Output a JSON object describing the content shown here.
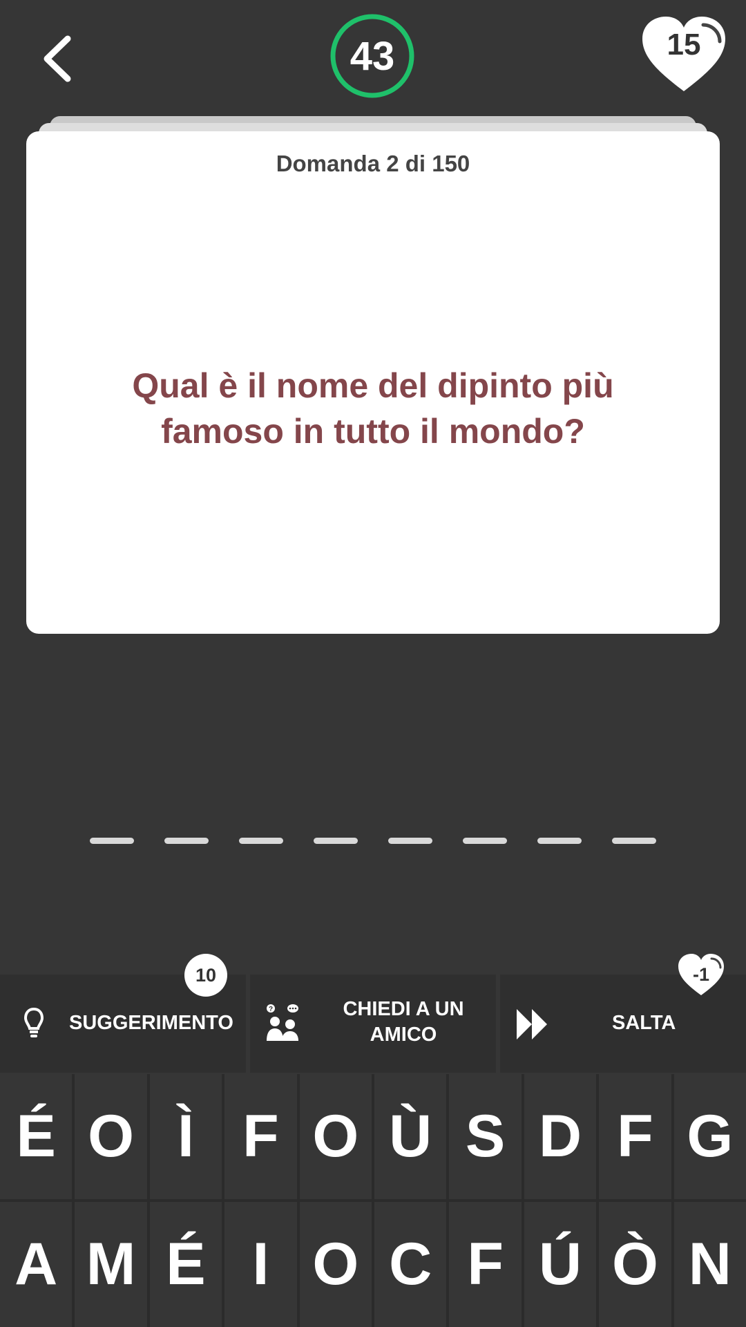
{
  "header": {
    "back_icon": "chevron-left-icon",
    "timer_value": "43",
    "timer_color": "#1fc06a",
    "lives_value": "15"
  },
  "card": {
    "counter": "Domanda 2 di 150",
    "question": "Qual è il nome del dipinto più famoso in tutto il mondo?",
    "question_color": "#84464b"
  },
  "answer": {
    "slot_count": 8
  },
  "help_bar": {
    "hint": {
      "label": "SUGGERIMENTO",
      "icon": "lightbulb-icon",
      "badge": "10"
    },
    "ask_friend": {
      "label_line1": "CHIEDI A UN",
      "label_line2": "AMICO",
      "icon": "ask-friend-icon"
    },
    "skip": {
      "label": "SALTA",
      "icon": "fast-forward-icon",
      "badge": "-1"
    }
  },
  "keyboard": {
    "row1": [
      "É",
      "O",
      "Ì",
      "F",
      "O",
      "Ù",
      "S",
      "D",
      "F",
      "G"
    ],
    "row2": [
      "A",
      "M",
      "É",
      "I",
      "O",
      "C",
      "F",
      "Ú",
      "Ò",
      "N"
    ]
  }
}
